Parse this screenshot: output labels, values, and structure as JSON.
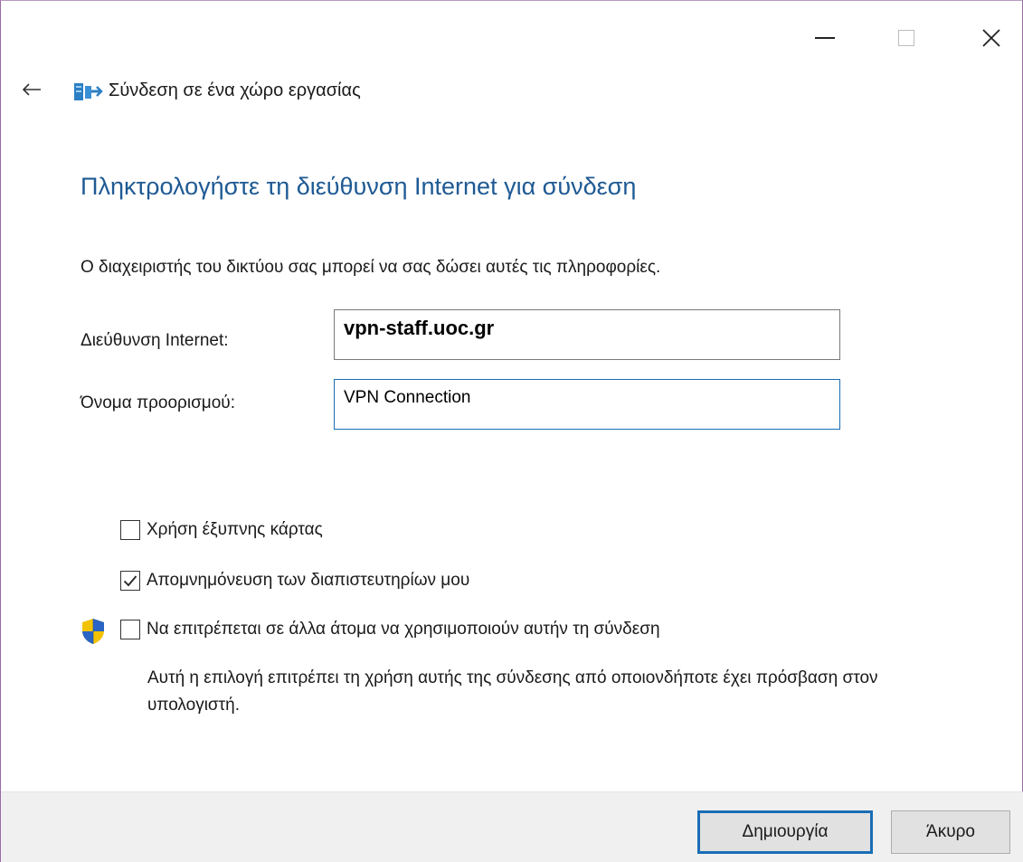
{
  "window": {
    "header_title": "Σύνδεση σε ένα χώρο εργασίας",
    "main_heading": "Πληκτρολογήστε τη διεύθυνση Internet για σύνδεση",
    "description": "Ο διαχειριστής του δικτύου σας μπορεί να σας δώσει αυτές τις πληροφορίες."
  },
  "form": {
    "address_label": "Διεύθυνση Internet:",
    "address_value": "vpn-staff.uoc.gr",
    "destination_label": "Όνομα προορισμού:",
    "destination_value": "VPN Connection"
  },
  "options": {
    "smart_card": {
      "label": "Χρήση έξυπνης κάρτας",
      "checked": false
    },
    "remember": {
      "label": "Απομνημόνευση των διαπιστευτηρίων μου",
      "checked": true
    },
    "allow_others": {
      "label": "Να επιτρέπεται σε άλλα άτομα να χρησιμοποιούν αυτήν τη σύνδεση",
      "checked": false
    },
    "allow_note": "Αυτή η επιλογή επιτρέπει τη χρήση αυτής της σύνδεσης από οποιονδήποτε έχει πρόσβαση στον υπολογιστή."
  },
  "buttons": {
    "create": "Δημιουργία",
    "cancel": "Άκυρο"
  },
  "icons": {
    "back": "back-arrow-icon",
    "network": "network-workplace-icon",
    "shield": "uac-shield-icon",
    "minimize": "minimize-icon",
    "maximize": "maximize-icon",
    "close": "close-icon"
  },
  "colors": {
    "heading": "#1f5a94",
    "focus_border": "#1a6db5",
    "footer_bg": "#f0f0f0"
  }
}
